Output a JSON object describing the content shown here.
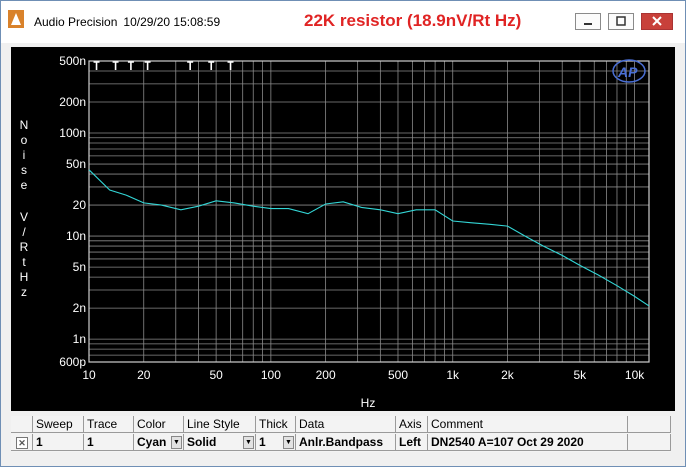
{
  "window": {
    "app_name": "Audio Precision",
    "datetime": "10/29/20 15:08:59",
    "annotation": "22K resistor (18.9nV/Rt Hz)"
  },
  "colors": {
    "trace": "#33d6d6",
    "annotation": "#e02424",
    "grid": "#8a8a8a",
    "plot_bg": "#000000"
  },
  "icons": {
    "app": "audio-precision-icon",
    "minimize": "minimize-icon",
    "maximize": "maximize-icon",
    "close": "close-icon",
    "logo": "ap-logo"
  },
  "chart_data": {
    "type": "line",
    "xlabel": "Hz",
    "ylabel": "Noise V/RtHz",
    "xscale": "log",
    "yscale": "log",
    "xlim": [
      10,
      12000
    ],
    "ylim": [
      6e-10,
      5e-07
    ],
    "x_ticks": [
      {
        "v": 10,
        "label": "10"
      },
      {
        "v": 20,
        "label": "20"
      },
      {
        "v": 50,
        "label": "50"
      },
      {
        "v": 100,
        "label": "100"
      },
      {
        "v": 200,
        "label": "200"
      },
      {
        "v": 500,
        "label": "500"
      },
      {
        "v": 1000,
        "label": "1k"
      },
      {
        "v": 2000,
        "label": "2k"
      },
      {
        "v": 5000,
        "label": "5k"
      },
      {
        "v": 10000,
        "label": "10k"
      }
    ],
    "y_ticks": [
      {
        "v": 5e-07,
        "label": "500n"
      },
      {
        "v": 2e-07,
        "label": "200n"
      },
      {
        "v": 1e-07,
        "label": "100n"
      },
      {
        "v": 5e-08,
        "label": "50n"
      },
      {
        "v": 2e-08,
        "label": "20"
      },
      {
        "v": 1e-08,
        "label": "10n"
      },
      {
        "v": 5e-09,
        "label": "5n"
      },
      {
        "v": 2e-09,
        "label": "2n"
      },
      {
        "v": 1e-09,
        "label": "1n"
      },
      {
        "v": 6e-10,
        "label": "600p"
      }
    ],
    "grid": true,
    "series": [
      {
        "color": "#33d6d6",
        "x": [
          10,
          13,
          16,
          20,
          25,
          32,
          40,
          50,
          63,
          80,
          100,
          125,
          160,
          200,
          250,
          315,
          400,
          500,
          630,
          800,
          1000,
          1250,
          1600,
          2000,
          2500,
          3150,
          4000,
          5000,
          6300,
          8000,
          10000,
          12000
        ],
        "y": [
          4.4e-08,
          2.8e-08,
          2.5e-08,
          2.1e-08,
          2e-08,
          1.8e-08,
          1.95e-08,
          2.2e-08,
          2.1e-08,
          1.95e-08,
          1.85e-08,
          1.85e-08,
          1.65e-08,
          2.05e-08,
          2.15e-08,
          1.9e-08,
          1.8e-08,
          1.65e-08,
          1.8e-08,
          1.8e-08,
          1.4e-08,
          1.35e-08,
          1.3e-08,
          1.25e-08,
          1e-08,
          8e-09,
          6.5e-09,
          5.2e-09,
          4.2e-09,
          3.3e-09,
          2.6e-09,
          2.1e-09
        ]
      }
    ],
    "markers": [
      11,
      14,
      17,
      21,
      36,
      47,
      60
    ]
  },
  "table": {
    "headers": [
      "Sweep",
      "Trace",
      "Color",
      "Line Style",
      "Thick",
      "Data",
      "Axis",
      "Comment"
    ],
    "row": {
      "sweep": "1",
      "trace": "1",
      "color": "Cyan",
      "line_style": "Solid",
      "thick": "1",
      "data": "Anlr.Bandpass",
      "axis": "Left",
      "comment": "DN2540 A=107 Oct 29 2020"
    }
  }
}
